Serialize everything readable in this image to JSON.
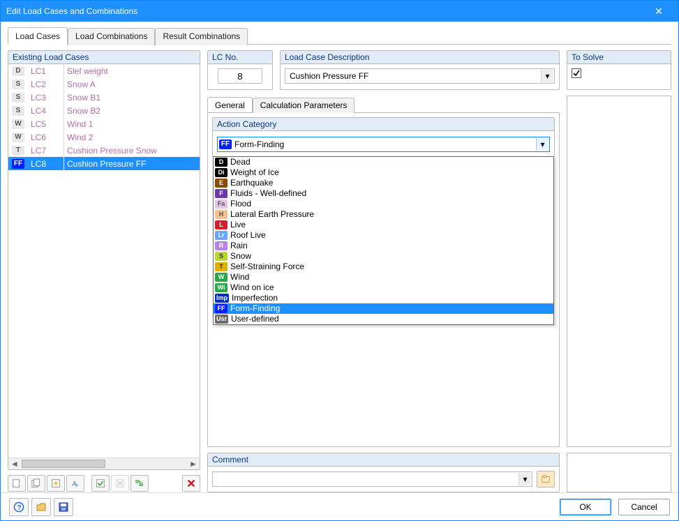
{
  "window": {
    "title": "Edit Load Cases and Combinations"
  },
  "tabs": {
    "loadCases": "Load Cases",
    "loadCombinations": "Load Combinations",
    "resultCombinations": "Result Combinations"
  },
  "existing": {
    "title": "Existing Load Cases",
    "rows": [
      {
        "tagText": "D",
        "tagBg": "#e8e8e8",
        "tagColor": "#555",
        "lc": "LC1",
        "name": "Slef weight"
      },
      {
        "tagText": "S",
        "tagBg": "#e8e8e8",
        "tagColor": "#555",
        "lc": "LC2",
        "name": "Snow A"
      },
      {
        "tagText": "S",
        "tagBg": "#e8e8e8",
        "tagColor": "#555",
        "lc": "LC3",
        "name": "Snow B1"
      },
      {
        "tagText": "S",
        "tagBg": "#e8e8e8",
        "tagColor": "#555",
        "lc": "LC4",
        "name": "Snow B2"
      },
      {
        "tagText": "W",
        "tagBg": "#e8e8e8",
        "tagColor": "#555",
        "lc": "LC5",
        "name": "Wind 1"
      },
      {
        "tagText": "W",
        "tagBg": "#e8e8e8",
        "tagColor": "#555",
        "lc": "LC6",
        "name": "Wind 2"
      },
      {
        "tagText": "T",
        "tagBg": "#e8e8e8",
        "tagColor": "#555",
        "lc": "LC7",
        "name": "Cushion Pressure Snow"
      },
      {
        "tagText": "FF",
        "tagBg": "#0020ff",
        "tagColor": "#fff",
        "lc": "LC8",
        "name": "Cushion Pressure FF",
        "selected": true
      }
    ]
  },
  "lcNo": {
    "title": "LC No.",
    "value": "8"
  },
  "description": {
    "title": "Load Case Description",
    "value": "Cushion Pressure FF"
  },
  "toSolve": {
    "title": "To Solve",
    "checked": true
  },
  "innerTabs": {
    "general": "General",
    "calcParams": "Calculation Parameters"
  },
  "actionCategory": {
    "title": "Action Category",
    "selected": {
      "tagText": "FF",
      "tagBg": "#0020ff",
      "tagColor": "#fff",
      "label": "Form-Finding"
    },
    "options": [
      {
        "tagText": "D",
        "tagBg": "#000000",
        "tagColor": "#fff",
        "label": "Dead"
      },
      {
        "tagText": "Di",
        "tagBg": "#000000",
        "tagColor": "#fff",
        "label": "Weight of Ice"
      },
      {
        "tagText": "E",
        "tagBg": "#8a4a00",
        "tagColor": "#fff",
        "label": "Earthquake"
      },
      {
        "tagText": "F",
        "tagBg": "#6a3aa6",
        "tagColor": "#fff",
        "label": "Fluids - Well-defined"
      },
      {
        "tagText": "Fa",
        "tagBg": "#e8c4e6",
        "tagColor": "#555",
        "label": "Flood"
      },
      {
        "tagText": "H",
        "tagBg": "#f6c08c",
        "tagColor": "#555",
        "label": "Lateral Earth Pressure"
      },
      {
        "tagText": "L",
        "tagBg": "#d02030",
        "tagColor": "#fff",
        "label": "Live"
      },
      {
        "tagText": "Lr",
        "tagBg": "#6aa6ff",
        "tagColor": "#fff",
        "label": "Roof Live"
      },
      {
        "tagText": "R",
        "tagBg": "#b784e0",
        "tagColor": "#fff",
        "label": "Rain"
      },
      {
        "tagText": "S",
        "tagBg": "#b8d62e",
        "tagColor": "#333",
        "label": "Snow"
      },
      {
        "tagText": "T",
        "tagBg": "#e0b000",
        "tagColor": "#333",
        "label": "Self-Straining Force"
      },
      {
        "tagText": "W",
        "tagBg": "#2aa64a",
        "tagColor": "#fff",
        "label": "Wind"
      },
      {
        "tagText": "Wi",
        "tagBg": "#2aa64a",
        "tagColor": "#fff",
        "label": "Wind on ice"
      },
      {
        "tagText": "Imp",
        "tagBg": "#0030c0",
        "tagColor": "#fff",
        "label": "Imperfection"
      },
      {
        "tagText": "FF",
        "tagBg": "#0020ff",
        "tagColor": "#fff",
        "label": "Form-Finding",
        "highlighted": true
      },
      {
        "tagText": "Usr",
        "tagBg": "#6a6a6a",
        "tagColor": "#fff",
        "label": "User-defined"
      }
    ]
  },
  "comment": {
    "title": "Comment",
    "value": ""
  },
  "footer": {
    "ok": "OK",
    "cancel": "Cancel"
  }
}
